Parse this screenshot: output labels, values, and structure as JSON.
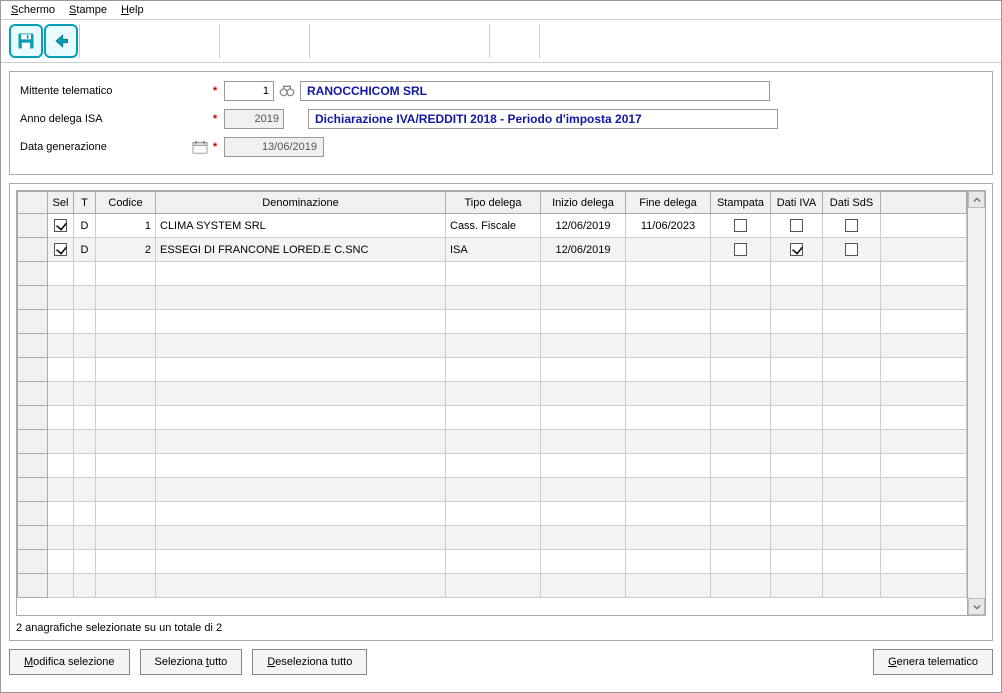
{
  "menu": {
    "schermo": "Schermo",
    "stampe": "Stampe",
    "help": "Help"
  },
  "form": {
    "mittente_label": "Mittente telematico",
    "mittente_code": "1",
    "mittente_name": "RANOCCHICOM SRL",
    "anno_label": "Anno delega ISA",
    "anno_value": "2019",
    "anno_desc": "Dichiarazione IVA/REDDITI 2018 - Periodo d'imposta 2017",
    "datagen_label": "Data generazione",
    "datagen_value": "13/06/2019"
  },
  "grid": {
    "headers": {
      "sel": "Sel",
      "t": "T",
      "codice": "Codice",
      "denominazione": "Denominazione",
      "tipo_delega": "Tipo delega",
      "inizio_delega": "Inizio delega",
      "fine_delega": "Fine delega",
      "stampata": "Stampata",
      "dati_iva": "Dati IVA",
      "dati_sds": "Dati SdS"
    },
    "rows": [
      {
        "sel": true,
        "t": "D",
        "codice": "1",
        "denominazione": "CLIMA SYSTEM SRL",
        "tipo_delega": "Cass. Fiscale",
        "inizio_delega": "12/06/2019",
        "fine_delega": "11/06/2023",
        "stampata": false,
        "dati_iva": false,
        "dati_sds": false
      },
      {
        "sel": true,
        "t": "D",
        "codice": "2",
        "denominazione": "ESSEGI DI FRANCONE LORED.E C.SNC",
        "tipo_delega": "ISA",
        "inizio_delega": "12/06/2019",
        "fine_delega": "",
        "stampata": false,
        "dati_iva": true,
        "dati_sds": false
      }
    ]
  },
  "status_text": "2 anagrafiche selezionate su un totale di 2",
  "buttons": {
    "modifica": "Modifica selezione",
    "seleziona_tutto": "Seleziona tutto",
    "deseleziona_tutto": "Deseleziona tutto",
    "genera": "Genera telematico"
  }
}
